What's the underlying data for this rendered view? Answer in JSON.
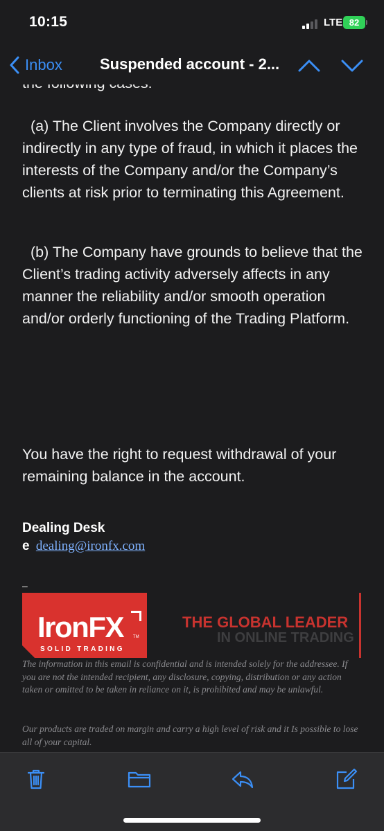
{
  "status_bar": {
    "time": "10:15",
    "network": "LTE",
    "battery_level": "82",
    "battery_color": "#30d158",
    "signal_bars_active": 2,
    "signal_bars_total": 4
  },
  "nav": {
    "back_label": "Inbox",
    "title": "Suspended account - 2...",
    "up_icon": "chevron-up-icon",
    "down_icon": "chevron-down-icon",
    "accent_color": "#3b8ff6"
  },
  "email": {
    "cut_text": "the following cases:",
    "clause_a": "(a) The Client involves the Company directly or indirectly in any type of fraud, in which it places the interests of the Company and/or the Company’s clients at risk prior to terminating this Agreement.",
    "clause_b": "(b) The Company have grounds to believe that the Client’s trading activity adversely affects in any manner the reliability and/or smooth operation and/or orderly functioning of the Trading Platform.",
    "withdrawal_note": "You have the right to request withdrawal of your remaining balance in the account.",
    "signature": {
      "name": "Dealing Desk",
      "email_prefix": "e",
      "email": "dealing@ironfx.com",
      "separator": "–"
    },
    "banner": {
      "logo_text": "IronFX",
      "logo_tm": "TM",
      "logo_tagline": "SOLID TRADING",
      "headline": "THE GLOBAL LEADER",
      "subheadline": "IN ONLINE TRADING",
      "brand_color": "#d9322e"
    },
    "disclaimer_1": "The information in this email is confidential and is intended solely for the addressee. If you are not the intended recipient, any disclosure, copying, distribution or any action taken or omitted to be taken in reliance on it, is prohibited and may be unlawful.",
    "disclaimer_2": "Our products are traded on margin and carry a high level of risk and it Is possible to lose all of your capital."
  },
  "toolbar": {
    "items": [
      {
        "name": "trash-icon"
      },
      {
        "name": "folder-icon"
      },
      {
        "name": "reply-icon"
      },
      {
        "name": "compose-icon"
      }
    ]
  }
}
